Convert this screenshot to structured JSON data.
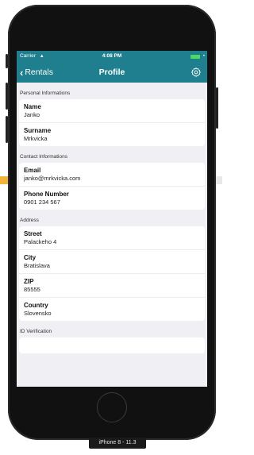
{
  "status_bar": {
    "carrier": "Carrier",
    "time": "4:08 PM"
  },
  "nav": {
    "back_label": "Rentals",
    "title": "Profile"
  },
  "sections": [
    {
      "header": "Personal Informations",
      "fields": [
        {
          "label": "Name",
          "value": "Janko"
        },
        {
          "label": "Surname",
          "value": "Mrkvicka"
        }
      ]
    },
    {
      "header": "Contact Informations",
      "fields": [
        {
          "label": "Email",
          "value": "janko@mrkvicka.com"
        },
        {
          "label": "Phone Number",
          "value": "0901 234 567"
        }
      ]
    },
    {
      "header": "Address",
      "fields": [
        {
          "label": "Street",
          "value": "Palackeho 4"
        },
        {
          "label": "City",
          "value": "Bratislava"
        },
        {
          "label": "ZIP",
          "value": "85555"
        },
        {
          "label": "Country",
          "value": "Slovensko"
        }
      ]
    },
    {
      "header": "ID Verification",
      "fields": []
    }
  ],
  "device_label": "iPhone 8 - 11.3",
  "colors": {
    "nav_background": "#1f7f8f",
    "screen_background": "#efeff4"
  },
  "icons": {
    "back": "chevron-left-icon",
    "settings": "gear-icon",
    "wifi": "wifi-icon",
    "battery": "battery-icon"
  }
}
